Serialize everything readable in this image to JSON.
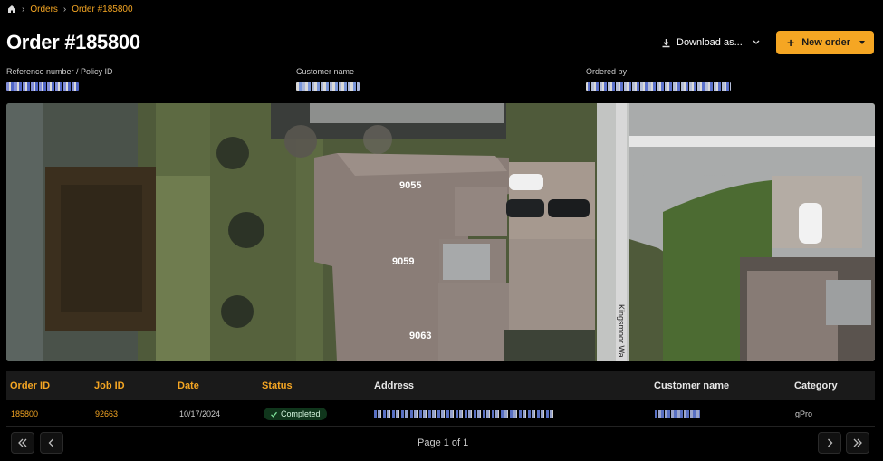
{
  "breadcrumb": {
    "items": [
      "Orders",
      "Order #185800"
    ]
  },
  "page": {
    "title": "Order #185800"
  },
  "toolbar": {
    "download_label": "Download as...",
    "new_order_label": "New order"
  },
  "info": {
    "reference_label": "Reference number / Policy ID",
    "customer_label": "Customer name",
    "ordered_by_label": "Ordered by"
  },
  "map": {
    "house_numbers": [
      "9055",
      "9059",
      "9063"
    ],
    "street_label": "Kingsmoor Wa"
  },
  "table": {
    "headers": [
      "Order ID",
      "Job ID",
      "Date",
      "Status",
      "Address",
      "Customer name",
      "Category"
    ],
    "rows": [
      {
        "order_id": "185800",
        "job_id": "92663",
        "date": "10/17/2024",
        "status": "Completed",
        "category": "gPro"
      }
    ]
  },
  "pagination": {
    "label": "Page 1 of 1"
  },
  "colors": {
    "accent": "#f5a623",
    "status_green": "#10361c"
  }
}
